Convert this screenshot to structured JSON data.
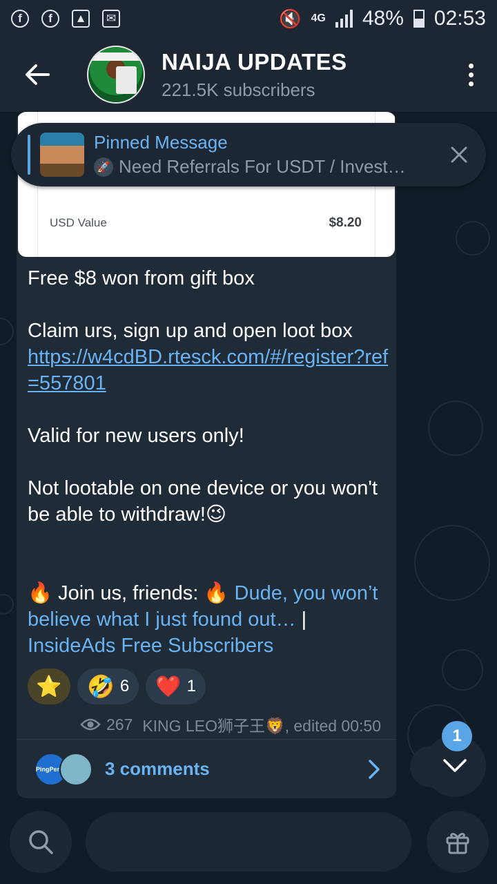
{
  "status_bar": {
    "battery": "48%",
    "network": "4G",
    "time": "02:53"
  },
  "header": {
    "channel_name": "NAIJA UPDATES",
    "subscribers": "221.5K subscribers"
  },
  "pinned": {
    "title": "Pinned Message",
    "preview": "Need Referrals For USDT / Invest…"
  },
  "media": {
    "row_label": "USD Value",
    "row_value": "$8.20"
  },
  "message": {
    "line1": "Free $8 won from gift box",
    "line2": "Claim urs, sign up and open loot box",
    "link": "https://w4cdBD.rtesck.com/#/register?ref=557801",
    "line3": "Valid for new users only!",
    "line4": "Not lootable on one device or you won't be able to withdraw!😉",
    "promo_prefix": "🔥 Join us, friends: 🔥",
    "promo_link_a": "Dude, you won’t believe what I just found out…",
    "promo_sep": "|",
    "promo_link_b": "InsideAds Free Subscribers"
  },
  "reactions": [
    {
      "emoji": "⭐",
      "count": ""
    },
    {
      "emoji": "🤣",
      "count": "6"
    },
    {
      "emoji": "❤️",
      "count": "1"
    }
  ],
  "meta": {
    "views": "267",
    "author_edited": "KING LEO狮子王🦁, edited 00:50"
  },
  "comments": {
    "label": "3 comments",
    "avatar1_text": "PingPerks"
  },
  "scroll_badge": "1",
  "colors": {
    "accent": "#6ab3f3",
    "header_bg": "#1c2733",
    "bubble_bg": "#1f2b37"
  }
}
